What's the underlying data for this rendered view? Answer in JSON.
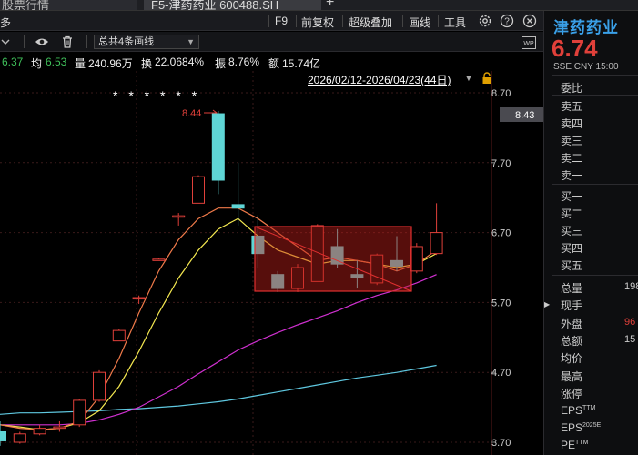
{
  "tabs": [
    {
      "label": "股票行情"
    },
    {
      "label": "F5-津药药业 600488.SH"
    }
  ],
  "toolbar": {
    "left_label": "多",
    "f9": "F9",
    "fuquan": "前复权",
    "overlay": "超级叠加",
    "draw_line": "画线",
    "tools": "工具"
  },
  "drawing": {
    "summary": "总共4条画线"
  },
  "quote": {
    "price_partial": "6.37",
    "avg_label": "均",
    "avg": "6.53",
    "vol_label": "量",
    "vol": "240.96万",
    "turnover_label": "换",
    "turnover": "22.0684%",
    "amp_label": "振",
    "amp": "8.76%",
    "amount_label": "额",
    "amount": "15.74亿"
  },
  "chart": {
    "date_range": "2026/02/12-2026/04/23(44日)",
    "markers": "* * * * * *",
    "high_label": "8.44",
    "price_tag": "8.43",
    "y_ticks": [
      "8.70",
      "7.70",
      "6.70",
      "5.70",
      "4.70",
      "3.70"
    ],
    "colors": {
      "up": "#e0403a",
      "down": "#5fd6d6",
      "ma5": "#f07a4a",
      "ma10": "#f4e850",
      "ma20": "#d030d0",
      "ma60": "#5fc8e0"
    }
  },
  "chart_data": {
    "type": "candlestick",
    "ylim": [
      3.7,
      8.7
    ],
    "y_ticks": [
      8.7,
      7.7,
      6.7,
      5.7,
      4.7,
      3.7
    ],
    "candles": [
      {
        "o": 3.85,
        "c": 3.72,
        "h": 4.0,
        "l": 3.65
      },
      {
        "o": 3.7,
        "c": 3.82,
        "h": 3.85,
        "l": 3.68
      },
      {
        "o": 3.82,
        "c": 3.9,
        "h": 3.95,
        "l": 3.8
      },
      {
        "o": 3.9,
        "c": 3.92,
        "h": 4.0,
        "l": 3.85
      },
      {
        "o": 3.95,
        "c": 4.3,
        "h": 4.32,
        "l": 3.92
      },
      {
        "o": 4.3,
        "c": 4.7,
        "h": 4.73,
        "l": 4.28
      },
      {
        "o": 5.15,
        "c": 5.3,
        "h": 5.32,
        "l": 5.15
      },
      {
        "o": 5.75,
        "c": 5.77,
        "h": 5.8,
        "l": 5.68
      },
      {
        "o": 6.3,
        "c": 6.32,
        "h": 6.33,
        "l": 6.3
      },
      {
        "o": 6.92,
        "c": 6.94,
        "h": 6.98,
        "l": 6.8
      },
      {
        "o": 7.12,
        "c": 7.5,
        "h": 7.52,
        "l": 7.12
      },
      {
        "o": 8.4,
        "c": 7.45,
        "h": 8.44,
        "l": 7.25
      },
      {
        "o": 7.1,
        "c": 7.05,
        "h": 7.7,
        "l": 6.8
      },
      {
        "o": 6.65,
        "c": 6.4,
        "h": 6.95,
        "l": 6.2
      },
      {
        "o": 6.1,
        "c": 5.9,
        "h": 6.15,
        "l": 5.85
      },
      {
        "o": 5.9,
        "c": 6.2,
        "h": 6.25,
        "l": 5.85
      },
      {
        "o": 6.0,
        "c": 6.8,
        "h": 6.82,
        "l": 6.0
      },
      {
        "o": 6.5,
        "c": 6.25,
        "h": 6.75,
        "l": 6.2
      },
      {
        "o": 6.1,
        "c": 6.05,
        "h": 6.3,
        "l": 5.9
      },
      {
        "o": 5.98,
        "c": 6.38,
        "h": 6.4,
        "l": 5.95
      },
      {
        "o": 6.3,
        "c": 6.22,
        "h": 6.65,
        "l": 6.15
      },
      {
        "o": 6.15,
        "c": 6.5,
        "h": 6.55,
        "l": 6.12
      },
      {
        "o": 6.4,
        "c": 6.7,
        "h": 7.12,
        "l": 6.38
      }
    ],
    "ma5": [
      3.95,
      3.9,
      3.88,
      3.9,
      4.0,
      4.35,
      4.9,
      5.55,
      6.15,
      6.6,
      6.9,
      7.05,
      7.05,
      6.9,
      6.7,
      6.5,
      6.3,
      6.35,
      6.3,
      6.25,
      6.15,
      6.25,
      6.45
    ],
    "ma10": [
      3.95,
      3.92,
      3.88,
      3.9,
      3.98,
      4.15,
      4.5,
      5.0,
      5.55,
      6.05,
      6.45,
      6.75,
      6.9,
      6.65,
      6.45,
      6.35,
      6.25,
      6.3,
      6.3,
      6.25,
      6.2,
      6.25,
      6.4
    ],
    "ma20": [
      3.95,
      3.95,
      3.95,
      3.95,
      3.97,
      4.02,
      4.1,
      4.2,
      4.35,
      4.5,
      4.68,
      4.85,
      5.02,
      5.15,
      5.27,
      5.38,
      5.48,
      5.58,
      5.7,
      5.8,
      5.88,
      5.98,
      6.1
    ],
    "ma60": [
      4.1,
      4.12,
      4.12,
      4.13,
      4.14,
      4.15,
      4.17,
      4.18,
      4.2,
      4.22,
      4.25,
      4.28,
      4.32,
      4.37,
      4.42,
      4.47,
      4.52,
      4.57,
      4.62,
      4.66,
      4.7,
      4.75,
      4.8
    ]
  },
  "panel": {
    "name": "津药药业",
    "price": "6.74",
    "exchange": "SSE",
    "currency": "CNY",
    "time": "15:00",
    "weibi": "委比",
    "sells": [
      "卖五",
      "卖四",
      "卖三",
      "卖二",
      "卖一"
    ],
    "buys": [
      "买一",
      "买二",
      "买三",
      "买四",
      "买五"
    ],
    "stats": [
      {
        "label": "总量",
        "value": "198"
      },
      {
        "label": "现手",
        "value": ""
      },
      {
        "label": "外盘",
        "value": "96"
      },
      {
        "label": "总额",
        "value": "15"
      },
      {
        "label": "均价",
        "value": ""
      },
      {
        "label": "最高",
        "value": ""
      },
      {
        "label": "涨停",
        "value": ""
      }
    ],
    "eps": [
      {
        "label": "EPS",
        "sup": "TTM"
      },
      {
        "label": "EPS",
        "sup": "2025E"
      },
      {
        "label": "PE",
        "sup": "TTM"
      }
    ]
  }
}
